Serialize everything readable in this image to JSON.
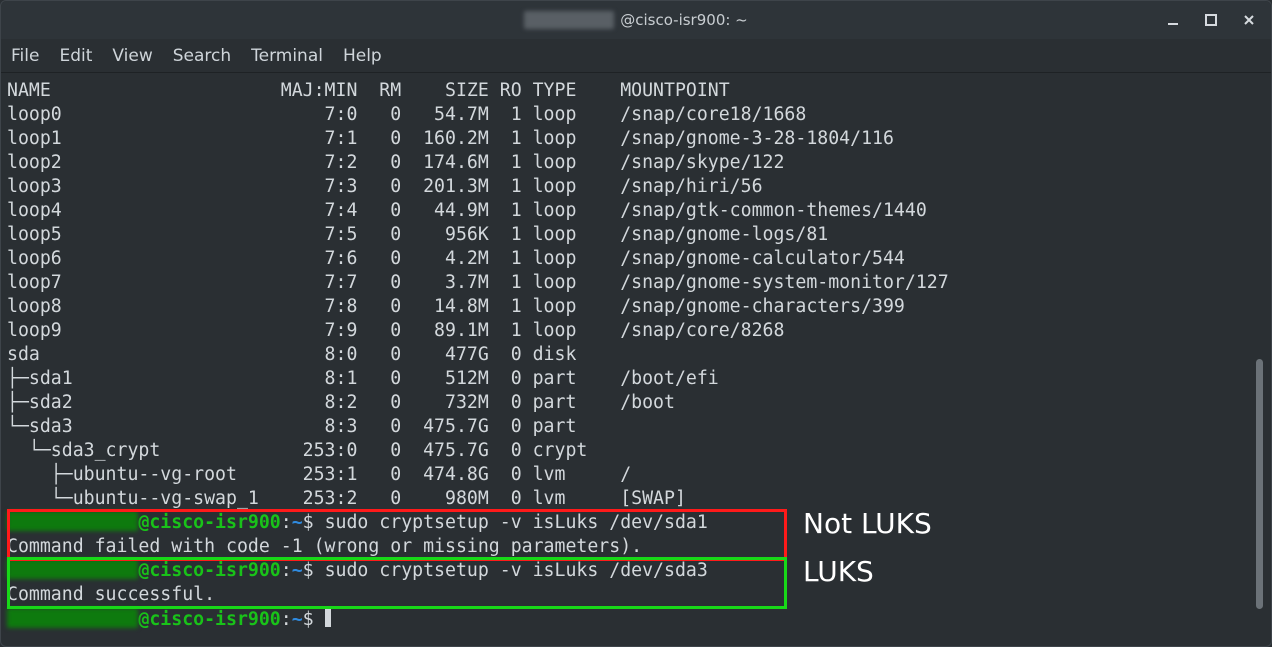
{
  "window": {
    "title_user_obfuscated": true,
    "title_host": "@cisco-isr900: ~"
  },
  "menu": {
    "items": [
      "File",
      "Edit",
      "View",
      "Search",
      "Terminal",
      "Help"
    ]
  },
  "lsblk_header": [
    "NAME",
    "MAJ:MIN",
    "RM",
    "SIZE",
    "RO",
    "TYPE",
    "MOUNTPOINT"
  ],
  "lsblk_rows": [
    {
      "name": "loop0",
      "maj": "7:0",
      "rm": "0",
      "size": "54.7M",
      "ro": "1",
      "type": "loop",
      "mp": "/snap/core18/1668"
    },
    {
      "name": "loop1",
      "maj": "7:1",
      "rm": "0",
      "size": "160.2M",
      "ro": "1",
      "type": "loop",
      "mp": "/snap/gnome-3-28-1804/116"
    },
    {
      "name": "loop2",
      "maj": "7:2",
      "rm": "0",
      "size": "174.6M",
      "ro": "1",
      "type": "loop",
      "mp": "/snap/skype/122"
    },
    {
      "name": "loop3",
      "maj": "7:3",
      "rm": "0",
      "size": "201.3M",
      "ro": "1",
      "type": "loop",
      "mp": "/snap/hiri/56"
    },
    {
      "name": "loop4",
      "maj": "7:4",
      "rm": "0",
      "size": "44.9M",
      "ro": "1",
      "type": "loop",
      "mp": "/snap/gtk-common-themes/1440"
    },
    {
      "name": "loop5",
      "maj": "7:5",
      "rm": "0",
      "size": "956K",
      "ro": "1",
      "type": "loop",
      "mp": "/snap/gnome-logs/81"
    },
    {
      "name": "loop6",
      "maj": "7:6",
      "rm": "0",
      "size": "4.2M",
      "ro": "1",
      "type": "loop",
      "mp": "/snap/gnome-calculator/544"
    },
    {
      "name": "loop7",
      "maj": "7:7",
      "rm": "0",
      "size": "3.7M",
      "ro": "1",
      "type": "loop",
      "mp": "/snap/gnome-system-monitor/127"
    },
    {
      "name": "loop8",
      "maj": "7:8",
      "rm": "0",
      "size": "14.8M",
      "ro": "1",
      "type": "loop",
      "mp": "/snap/gnome-characters/399"
    },
    {
      "name": "loop9",
      "maj": "7:9",
      "rm": "0",
      "size": "89.1M",
      "ro": "1",
      "type": "loop",
      "mp": "/snap/core/8268"
    },
    {
      "name": "sda",
      "maj": "8:0",
      "rm": "0",
      "size": "477G",
      "ro": "0",
      "type": "disk",
      "mp": ""
    },
    {
      "name": "├─sda1",
      "maj": "8:1",
      "rm": "0",
      "size": "512M",
      "ro": "0",
      "type": "part",
      "mp": "/boot/efi"
    },
    {
      "name": "├─sda2",
      "maj": "8:2",
      "rm": "0",
      "size": "732M",
      "ro": "0",
      "type": "part",
      "mp": "/boot"
    },
    {
      "name": "└─sda3",
      "maj": "8:3",
      "rm": "0",
      "size": "475.7G",
      "ro": "0",
      "type": "part",
      "mp": ""
    },
    {
      "name": "  └─sda3_crypt",
      "maj": "253:0",
      "rm": "0",
      "size": "475.7G",
      "ro": "0",
      "type": "crypt",
      "mp": ""
    },
    {
      "name": "    ├─ubuntu--vg-root",
      "maj": "253:1",
      "rm": "0",
      "size": "474.8G",
      "ro": "0",
      "type": "lvm",
      "mp": "/"
    },
    {
      "name": "    └─ubuntu--vg-swap_1",
      "maj": "253:2",
      "rm": "0",
      "size": "980M",
      "ro": "0",
      "type": "lvm",
      "mp": "[SWAP]"
    }
  ],
  "prompts": {
    "host": "cisco-isr900",
    "path": "~",
    "dollar": "$"
  },
  "cmd1": "sudo cryptsetup -v isLuks /dev/sda1",
  "out1": "Command failed with code -1 (wrong or missing parameters).",
  "cmd2": "sudo cryptsetup -v isLuks /dev/sda3",
  "out2": "Command successful.",
  "annotations": {
    "not_luks": "Not LUKS",
    "luks": "LUKS"
  },
  "colors": {
    "bg": "#2a2f33",
    "fg": "#d3d8dc",
    "prompt_green": "#19c219",
    "prompt_blue": "#2f8be0",
    "red_box": "#ff1a1a",
    "green_box": "#18d818"
  }
}
